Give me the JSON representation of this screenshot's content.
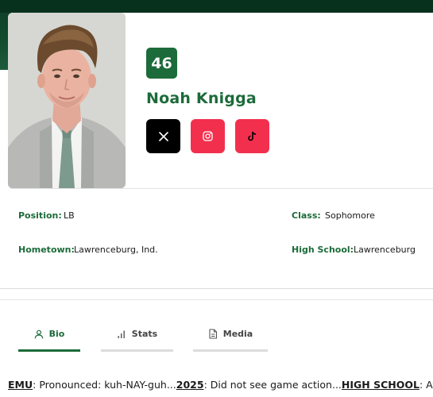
{
  "player": {
    "number": "46",
    "name": "Noah Knigga"
  },
  "social": [
    {
      "icon": "x-twitter-icon",
      "color": "#000000"
    },
    {
      "icon": "instagram-icon",
      "color": "#f2304e"
    },
    {
      "icon": "tiktok-icon",
      "color": "#f2304e"
    }
  ],
  "details": {
    "position_label": "Position:",
    "position_value": "LB",
    "class_label": "Class:",
    "class_value": "Sophomore",
    "hometown_label": "Hometown:",
    "hometown_value": "Lawrenceburg, Ind.",
    "highschool_label": "High School:",
    "highschool_value": "Lawrenceburg"
  },
  "tabs": [
    {
      "label": "Bio",
      "icon": "user-icon",
      "active": true
    },
    {
      "label": "Stats",
      "icon": "bar-chart-icon",
      "active": false
    },
    {
      "label": "Media",
      "icon": "document-icon",
      "active": false
    }
  ],
  "bio": {
    "emu_label": "EMU",
    "emu_text": ": Pronounced: kuh-NAY-guh...",
    "year_label": "2025",
    "year_text": ": Did not see game action...",
    "hs_label": "HIGH SCHOOL",
    "hs_text": ": Atter"
  },
  "colors": {
    "brand_green": "#1c6b3a",
    "header_dark": "#0d3d26",
    "social_pink": "#f2304e"
  }
}
